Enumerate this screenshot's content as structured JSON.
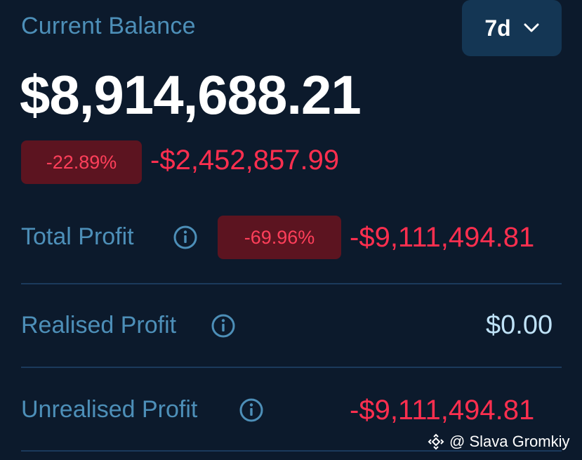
{
  "balance": {
    "label": "Current Balance",
    "amount": "$8,914,688.21",
    "change_percent": "-22.89%",
    "change_amount": "-$2,452,857.99"
  },
  "period_select": {
    "value": "7d",
    "icon": "chevron-down-icon"
  },
  "total_profit": {
    "label": "Total Profit",
    "percent": "-69.96%",
    "amount": "-$9,111,494.81",
    "icon": "info-icon"
  },
  "realised_profit": {
    "label": "Realised Profit",
    "amount": "$0.00",
    "icon": "info-icon"
  },
  "unrealised_profit": {
    "label": "Unrealised Profit",
    "amount": "-$9,111,494.81",
    "icon": "info-icon"
  },
  "watermark": {
    "text": "@ Slava Gromkiy",
    "icon": "binance-diamond-icon"
  },
  "colors": {
    "background": "#0c1a2c",
    "label": "#4d8fb8",
    "negative": "#ff2f4f",
    "badge_bg": "#5c1420",
    "neutral_value": "#bfe2f7",
    "select_bg": "#143654",
    "divider": "#1b3a5c"
  }
}
